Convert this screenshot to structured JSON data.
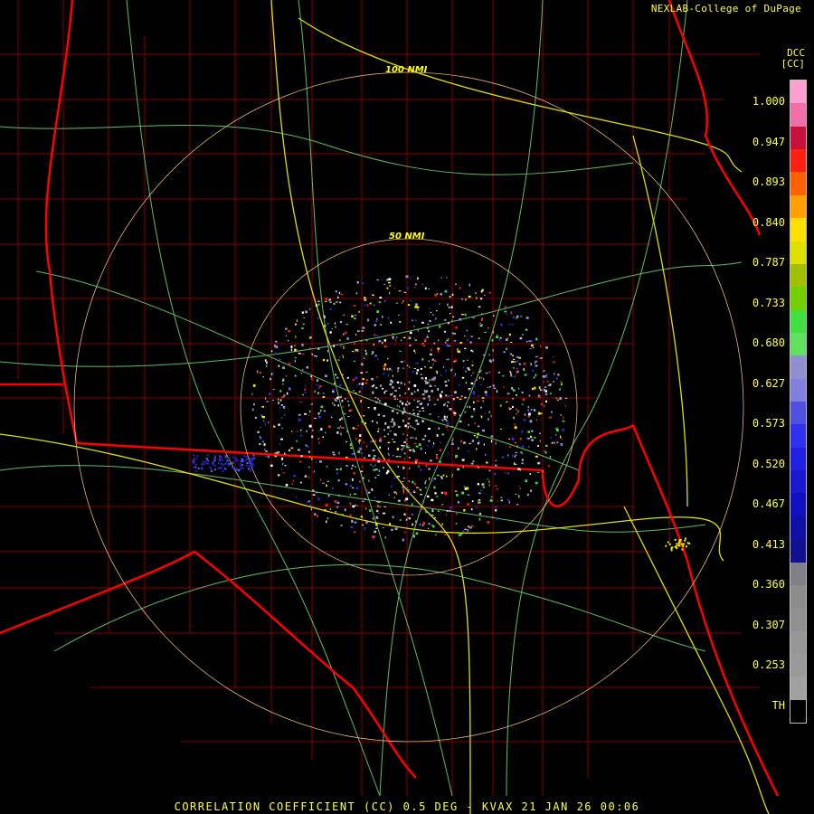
{
  "credit": "NEXLAB-College of DuPage",
  "product": {
    "code": "DCC",
    "unit": "[CC]"
  },
  "footer": "CORRELATION COEFFICIENT (CC) 0.5 DEG - KVAX 21 JAN 26 00:06",
  "range_rings": [
    "50 NMI",
    "100 NMI"
  ],
  "colorbar": {
    "ticks": [
      "1.000",
      "0.947",
      "0.893",
      "0.840",
      "0.787",
      "0.733",
      "0.680",
      "0.627",
      "0.573",
      "0.520",
      "0.467",
      "0.413",
      "0.360",
      "0.307",
      "0.253",
      "TH"
    ],
    "colors": [
      "#ff9fd0",
      "#f06fa8",
      "#c8103c",
      "#ff2010",
      "#ff6000",
      "#ffa000",
      "#ffe000",
      "#e0e000",
      "#a0c000",
      "#70d000",
      "#40e040",
      "#60e060",
      "#9090d0",
      "#8080e0",
      "#5050e0",
      "#3030f0",
      "#2020e0",
      "#1818d0",
      "#1010c0",
      "#1010a8",
      "#101090",
      "#808088",
      "#8c8c8c",
      "#909090",
      "#969696",
      "#9a9a9a",
      "#a0a0a0",
      "#000000"
    ]
  },
  "colors": {
    "state_border": "#ff0000",
    "county_border": "#b00000",
    "highway": "#e0e000",
    "road": "#80ff80",
    "ring": "#ffcc80",
    "label": "#ffff40"
  }
}
